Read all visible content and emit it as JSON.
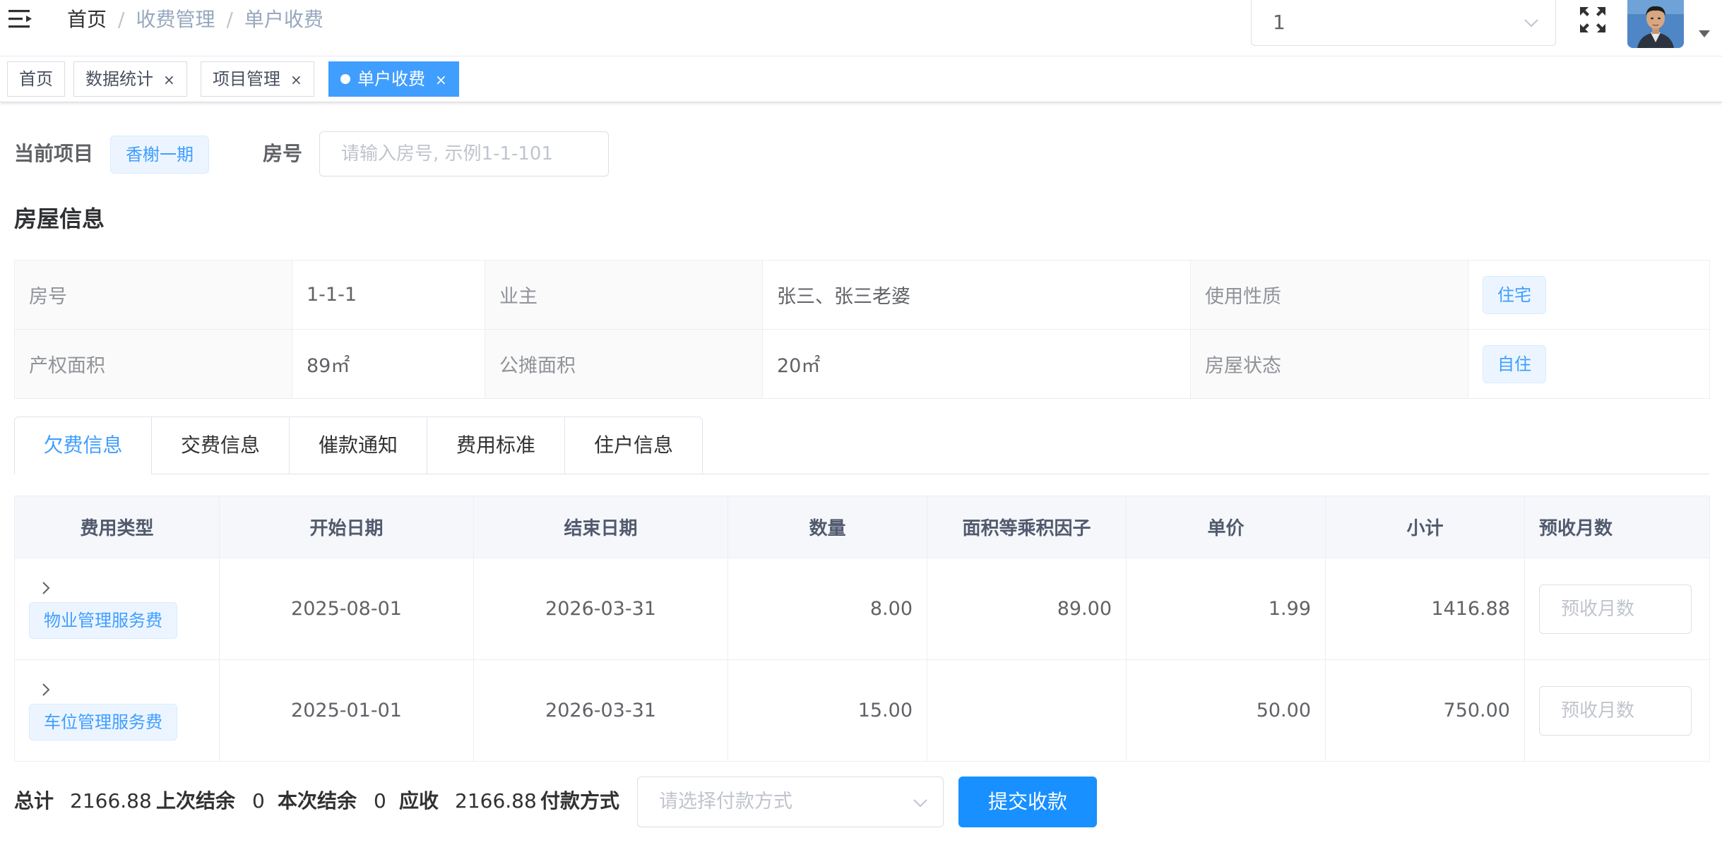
{
  "navbar": {
    "breadcrumb": [
      "首页",
      "收费管理",
      "单户收费"
    ],
    "breadcrumb_sep": "/",
    "project_select_value": "1"
  },
  "tags": [
    {
      "label": "首页",
      "closable": false,
      "active": false
    },
    {
      "label": "数据统计",
      "closable": true,
      "active": false
    },
    {
      "label": "项目管理",
      "closable": true,
      "active": false
    },
    {
      "label": "单户收费",
      "closable": true,
      "active": true
    }
  ],
  "tag_close_glyph": "×",
  "filter": {
    "project_label": "当前项目",
    "project_value": "香榭一期",
    "room_label": "房号",
    "room_placeholder": "请输入房号, 示例1-1-101"
  },
  "house": {
    "title": "房屋信息",
    "rows": [
      {
        "k1": "房号",
        "v1": "1-1-1",
        "k2": "业主",
        "v2": "张三、张三老婆",
        "k3": "使用性质",
        "v3": "住宅"
      },
      {
        "k1": "产权面积",
        "v1": "89㎡",
        "k2": "公摊面积",
        "v2": "20㎡",
        "k3": "房屋状态",
        "v3": "自住"
      }
    ]
  },
  "tabs": [
    "欠费信息",
    "交费信息",
    "催款通知",
    "费用标准",
    "住户信息"
  ],
  "active_tab": 0,
  "fee_table": {
    "headers": [
      "费用类型",
      "开始日期",
      "结束日期",
      "数量",
      "面积等乘积因子",
      "单价",
      "小计",
      "预收月数"
    ],
    "rows": [
      {
        "type": "物业管理服务费",
        "start": "2025-08-01",
        "end": "2026-03-31",
        "qty": "8.00",
        "factor": "89.00",
        "price": "1.99",
        "subtotal": "1416.88",
        "months_placeholder": "预收月数"
      },
      {
        "type": "车位管理服务费",
        "start": "2025-01-01",
        "end": "2026-03-31",
        "qty": "15.00",
        "factor": "",
        "price": "50.00",
        "subtotal": "750.00",
        "months_placeholder": "预收月数"
      }
    ]
  },
  "summary": {
    "total_label": "总计",
    "total": "2166.88",
    "last_balance_label": "上次结余",
    "last_balance": "0",
    "this_balance_label": "本次结余",
    "this_balance": "0",
    "receivable_label": "应收",
    "receivable": "2166.88",
    "pay_label": "付款方式",
    "pay_placeholder": "请选择付款方式",
    "submit_label": "提交收款"
  },
  "colors": {
    "primary": "#409eff",
    "button": "#1890ff",
    "tag_bg": "#ecf5ff"
  },
  "icons": [
    "hamburger-icon",
    "chevron-down-icon",
    "fullscreen-icon",
    "avatar",
    "caret-down-icon",
    "chevron-right-icon"
  ]
}
